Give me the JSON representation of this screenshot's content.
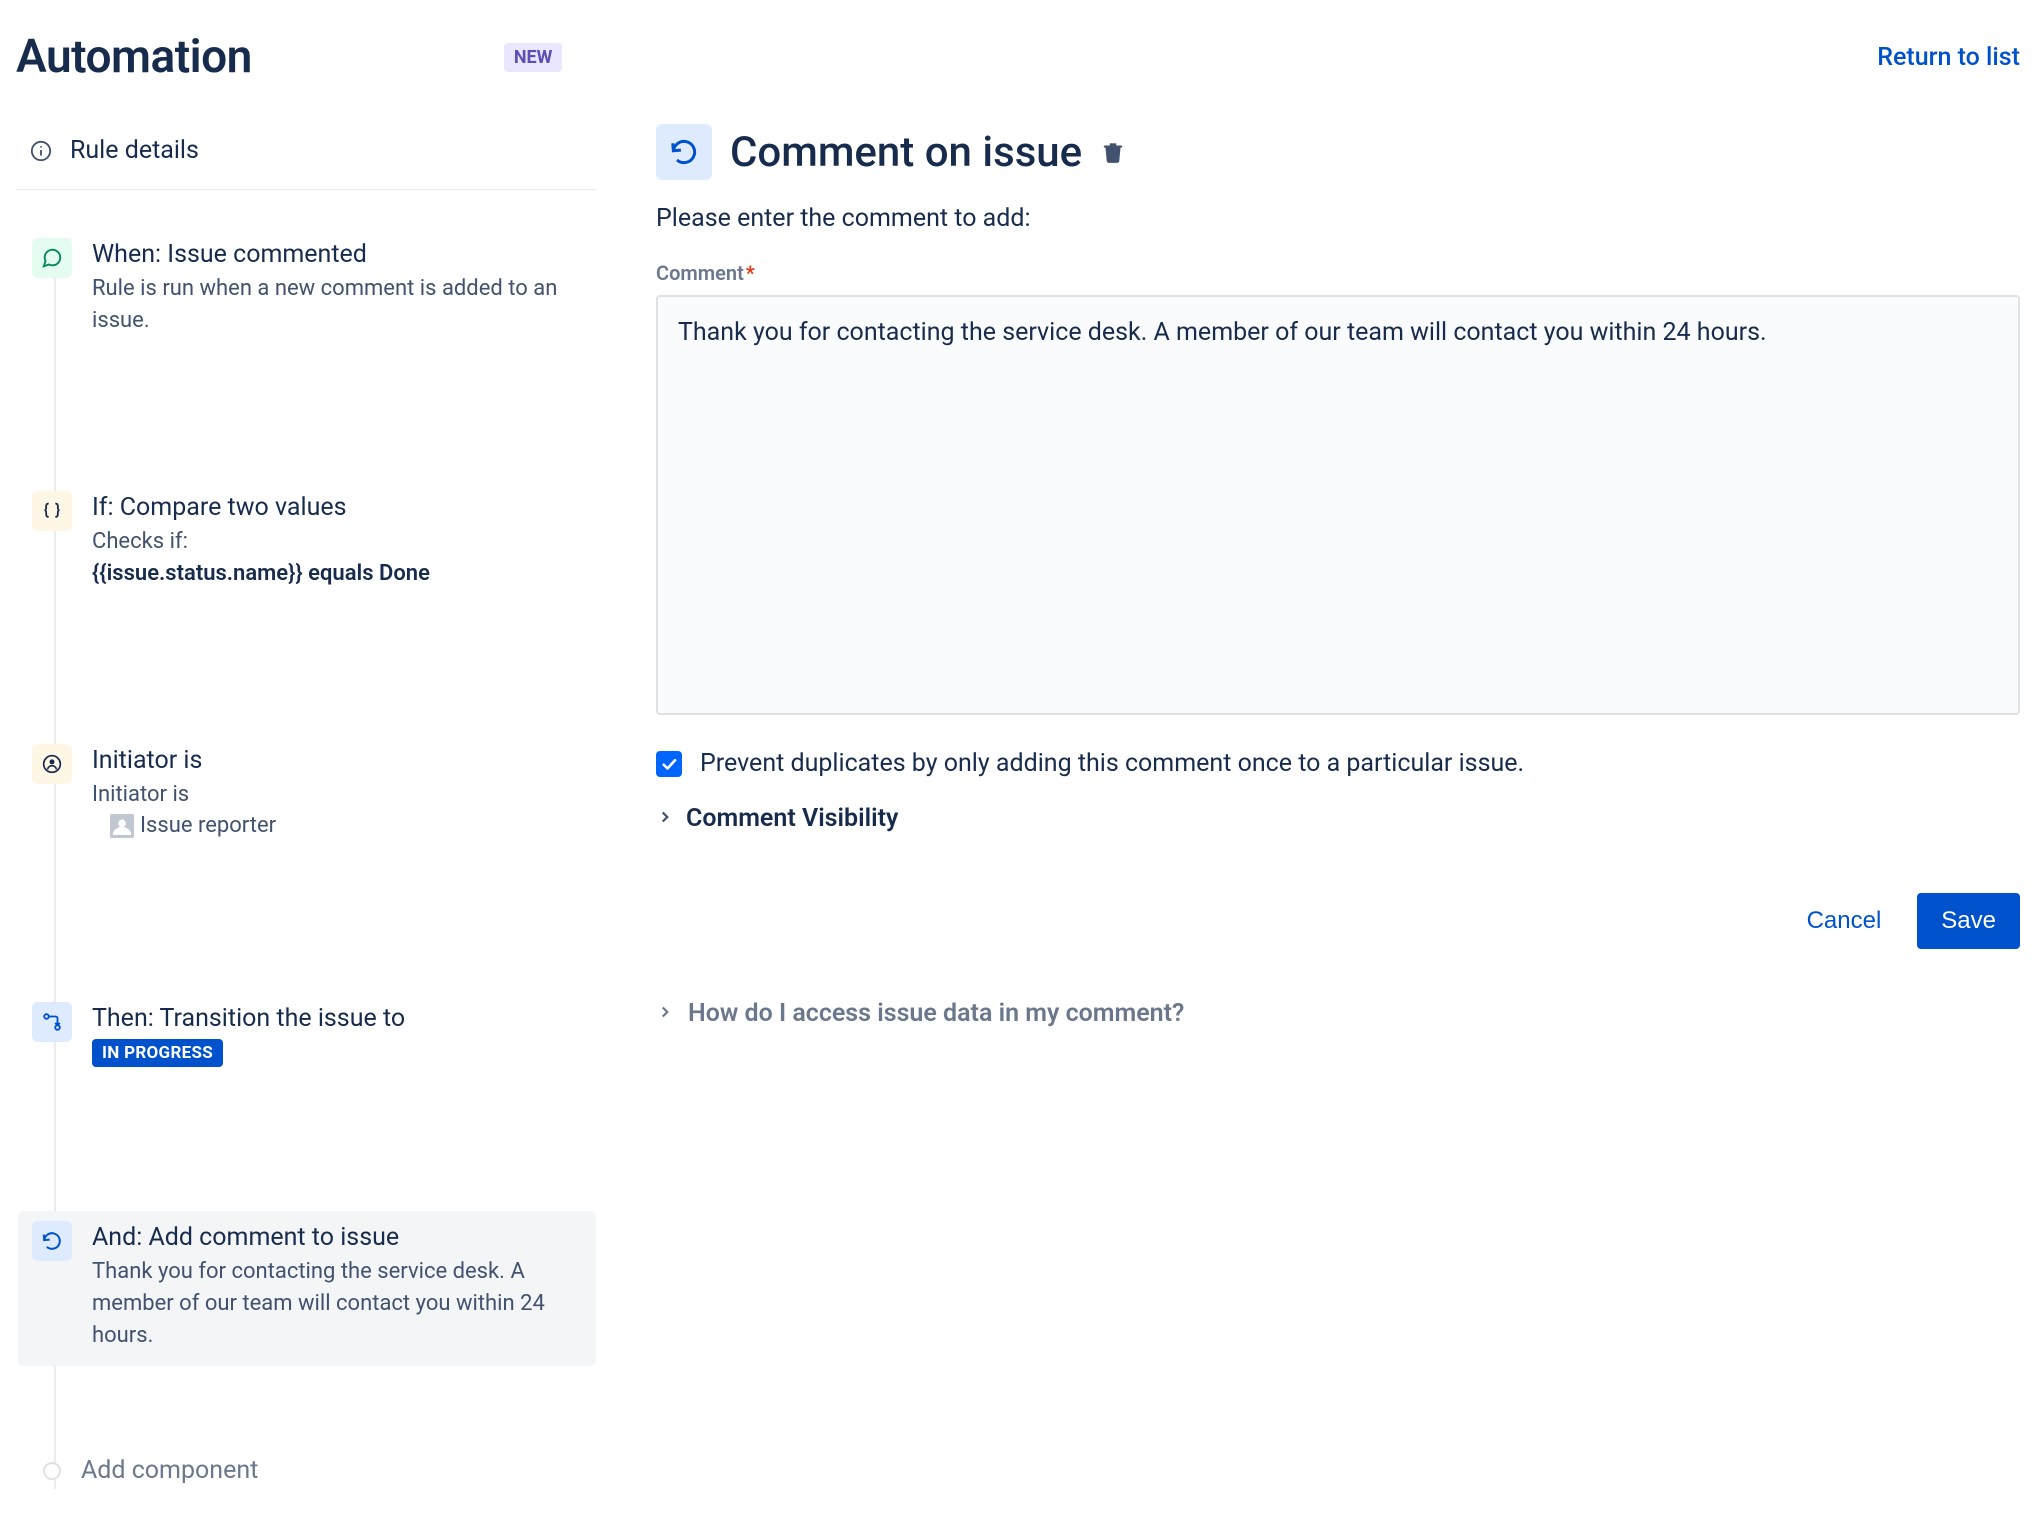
{
  "header": {
    "title": "Automation",
    "badge": "NEW",
    "return_link": "Return to list"
  },
  "sidebar": {
    "rule_details_label": "Rule details",
    "steps": {
      "trigger": {
        "title": "When: Issue commented",
        "desc": "Rule is run when a new comment is added to an issue."
      },
      "condition1": {
        "title": "If: Compare two values",
        "desc_prefix": "Checks if:",
        "desc_bold": "{{issue.status.name}} equals Done"
      },
      "condition2": {
        "title": "Initiator is",
        "desc_prefix": "Initiator is",
        "desc_value": "Issue reporter"
      },
      "action1": {
        "title": "Then: Transition the issue to",
        "status": "IN PROGRESS"
      },
      "action2": {
        "title": "And: Add comment to issue",
        "desc": "Thank you for contacting the service desk. A member of our team will contact you within 24 hours."
      }
    },
    "add_component": "Add component"
  },
  "main": {
    "title": "Comment on issue",
    "subtitle": "Please enter the comment to add:",
    "comment_label": "Comment",
    "required_mark": "*",
    "comment_value": "Thank you for contacting the service desk. A member of our team will contact you within 24 hours.",
    "prevent_duplicates_label": "Prevent duplicates by only adding this comment once to a particular issue.",
    "prevent_duplicates_checked": true,
    "visibility_label": "Comment Visibility",
    "cancel_label": "Cancel",
    "save_label": "Save",
    "help_label": "How do I access issue data in my comment?"
  }
}
